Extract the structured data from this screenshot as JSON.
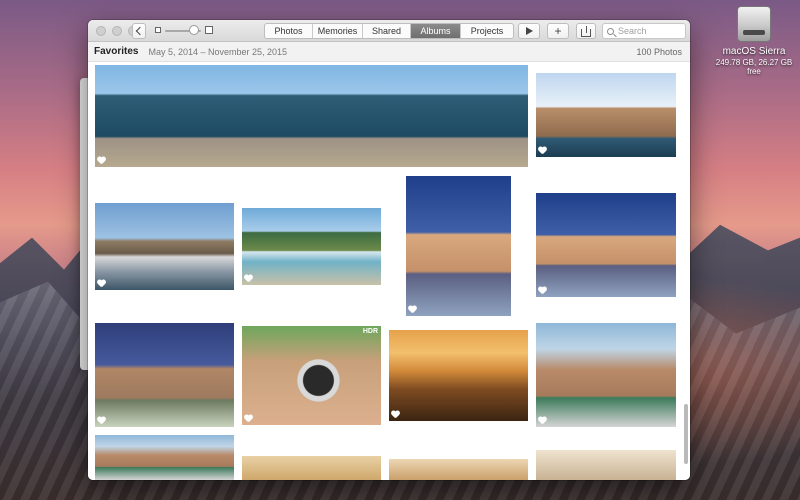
{
  "desktop": {
    "drive": {
      "name": "macOS Sierra",
      "size": "249.78 GB, 26.27 GB free"
    }
  },
  "window": {
    "toolbar": {
      "tabs": [
        {
          "label": "Photos",
          "active": false
        },
        {
          "label": "Memories",
          "active": false
        },
        {
          "label": "Shared",
          "active": false
        },
        {
          "label": "Albums",
          "active": true
        },
        {
          "label": "Projects",
          "active": false
        }
      ],
      "plus_label": "+",
      "search_placeholder": "Search"
    },
    "album": {
      "title": "Favorites",
      "date_range": "May 5, 2014 – November 25, 2015",
      "count": "100 Photos"
    },
    "photos": [
      {
        "name": "coast-panorama",
        "fav": true
      },
      {
        "name": "old-town",
        "fav": true
      },
      {
        "name": "harbor",
        "fav": true
      },
      {
        "name": "poolside",
        "fav": true
      },
      {
        "name": "selfie-lounge",
        "fav": true
      },
      {
        "name": "selfie-sunglasses",
        "fav": true
      },
      {
        "name": "selfie-blue",
        "fav": true
      },
      {
        "name": "watch",
        "fav": true,
        "badge": "HDR"
      },
      {
        "name": "sunset-beach",
        "fav": true
      },
      {
        "name": "friends",
        "fav": true
      }
    ],
    "colors": {
      "active_tab": "#7a7a7a",
      "window_bg": "#ffffff"
    }
  }
}
